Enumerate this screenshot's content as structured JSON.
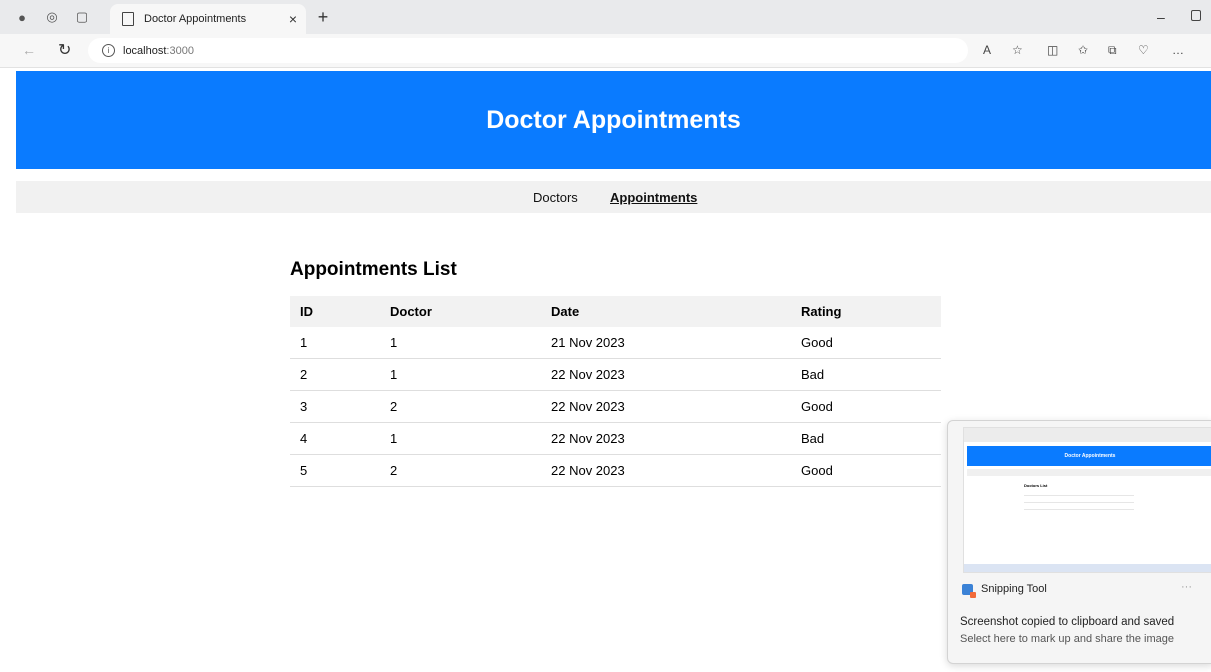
{
  "browser": {
    "tab_title": "Doctor Appointments",
    "url_host": "localhost",
    "url_port": ":3000"
  },
  "header": {
    "title": "Doctor Appointments"
  },
  "nav": {
    "items": [
      {
        "label": "Doctors"
      },
      {
        "label": "Appointments",
        "active": true
      }
    ]
  },
  "appointments": {
    "title": "Appointments List",
    "columns": [
      "ID",
      "Doctor",
      "Date",
      "Rating"
    ],
    "rows": [
      [
        "1",
        "1",
        "21 Nov 2023",
        "Good"
      ],
      [
        "2",
        "1",
        "22 Nov 2023",
        "Bad"
      ],
      [
        "3",
        "2",
        "22 Nov 2023",
        "Good"
      ],
      [
        "4",
        "1",
        "22 Nov 2023",
        "Bad"
      ],
      [
        "5",
        "2",
        "22 Nov 2023",
        "Good"
      ]
    ]
  },
  "toast": {
    "app_name": "Snipping Tool",
    "message": "Screenshot copied to clipboard and saved",
    "sub": "Select here to mark up and share the image",
    "thumbnail": {
      "header": "Doctor Appointments",
      "section": "Doctors List"
    }
  },
  "colors": {
    "brand": "#0a7bff",
    "nav_bg": "#f1f1f1",
    "table_header_bg": "#f2f2f2"
  }
}
